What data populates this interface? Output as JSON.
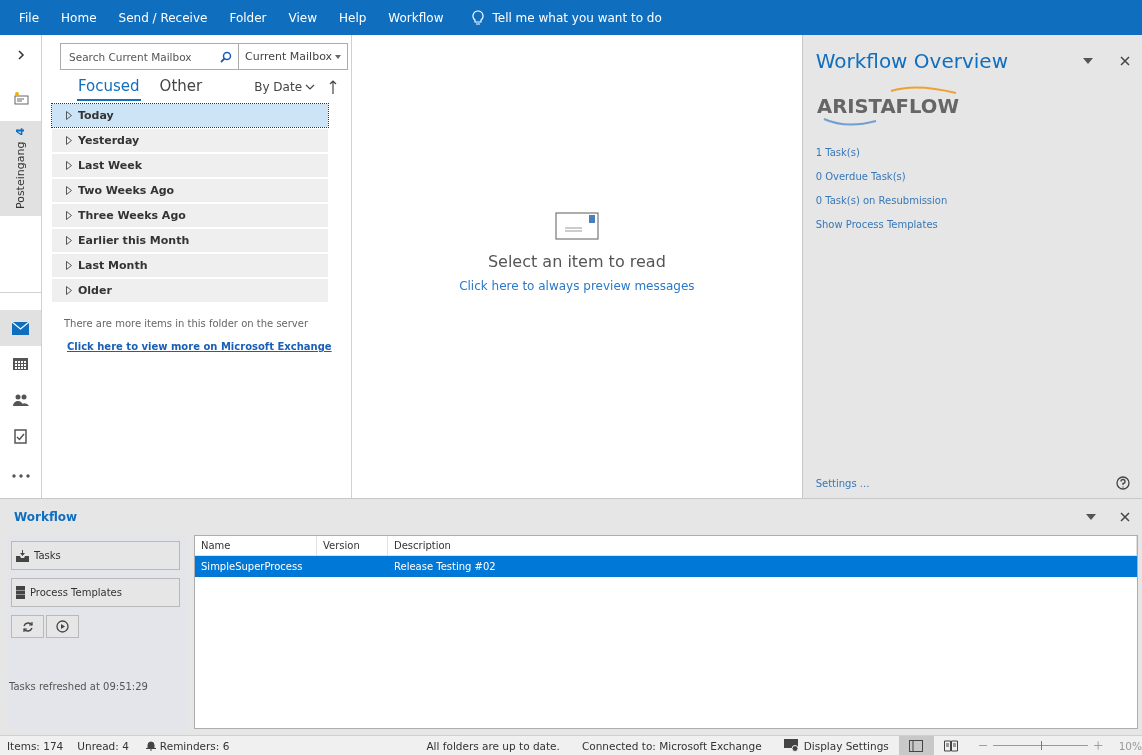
{
  "menu": [
    "File",
    "Home",
    "Send / Receive",
    "Folder",
    "View",
    "Help",
    "Workflow"
  ],
  "tell_me": "Tell me what you want to do",
  "nav_rail": {
    "folder": {
      "label": "Posteingang",
      "count": "4"
    }
  },
  "search": {
    "placeholder": "Search Current Mailbox",
    "scope": "Current Mailbox"
  },
  "tabs": [
    {
      "label": "Focused",
      "selected": true
    },
    {
      "label": "Other",
      "selected": false
    }
  ],
  "sort": "By Date",
  "groups": [
    {
      "label": "Today",
      "selected": true
    },
    {
      "label": "Yesterday",
      "selected": false
    },
    {
      "label": "Last Week",
      "selected": false
    },
    {
      "label": "Two Weeks Ago",
      "selected": false
    },
    {
      "label": "Three Weeks Ago",
      "selected": false
    },
    {
      "label": "Earlier this Month",
      "selected": false
    },
    {
      "label": "Last Month",
      "selected": false
    },
    {
      "label": "Older",
      "selected": false
    }
  ],
  "server_note": "There are more items in this folder on the server",
  "server_link": "Click here to view more on Microsoft Exchange",
  "reading_pane": {
    "message": "Select an item to read",
    "link": "Click here to always preview messages"
  },
  "overview": {
    "title": "Workflow Overview",
    "logo": "ARISTAFLOW",
    "links": [
      "1 Task(s)",
      "0 Overdue Task(s)",
      "0 Task(s) on Resubmission",
      "Show Process Templates"
    ],
    "settings": "Settings ..."
  },
  "workflow": {
    "title": "Workflow",
    "buttons": [
      "Tasks",
      "Process Templates"
    ],
    "refreshed": "Tasks refreshed at 09:51:29",
    "table": {
      "columns": [
        "Name",
        "Version",
        "Description"
      ],
      "rows": [
        {
          "name": "SimpleSuperProcess",
          "description": "Release Testing #02",
          "selected": true
        }
      ]
    }
  },
  "status_bar": {
    "items": "Items: 174",
    "unread": "Unread: 4",
    "reminders": "Reminders: 6",
    "sync": "All folders are up to date.",
    "connection": "Connected to: Microsoft Exchange",
    "display_settings": "Display Settings",
    "zoom": {
      "level": 0.5,
      "reading": "10%"
    }
  }
}
